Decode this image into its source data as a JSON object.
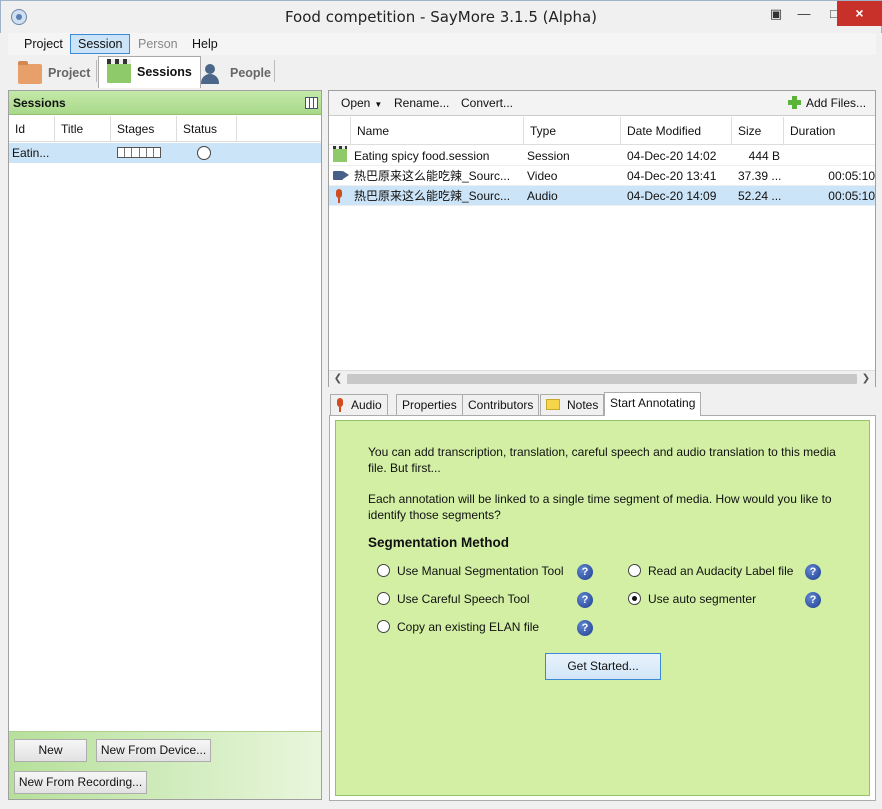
{
  "window": {
    "title": "Food competition - SayMore 3.1.5 (Alpha)",
    "close_glyph": "×",
    "maximize_glyph": "□",
    "minimize_glyph": "—"
  },
  "menu": {
    "items": [
      {
        "label": "Project",
        "state": "normal"
      },
      {
        "label": "Session",
        "state": "active"
      },
      {
        "label": "Person",
        "state": "disabled"
      },
      {
        "label": "Help",
        "state": "normal"
      }
    ]
  },
  "main_tabs": [
    {
      "label": "Project",
      "icon": "folder-icon"
    },
    {
      "label": "Sessions",
      "icon": "clapper-icon",
      "active": true
    },
    {
      "label": "People",
      "icon": "person-icon"
    }
  ],
  "sessions_panel": {
    "title": "Sessions",
    "columns": [
      "Id",
      "Title",
      "Stages",
      "Status"
    ],
    "rows": [
      {
        "id": "Eatin...",
        "title": "",
        "stages_segments": 6,
        "status": "empty-circle"
      }
    ],
    "buttons": {
      "new": "New",
      "new_from_device": "New From Device...",
      "new_from_recording": "New From Recording..."
    }
  },
  "files_panel": {
    "toolbar": {
      "open": "Open",
      "rename": "Rename...",
      "convert": "Convert...",
      "add_files": "Add Files..."
    },
    "columns": [
      "Name",
      "Type",
      "Date Modified",
      "Size",
      "Duration"
    ],
    "rows": [
      {
        "icon": "session-icon",
        "name": "Eating spicy food.session",
        "type": "Session",
        "date": "04-Dec-20 14:02",
        "size": "444 B",
        "duration": "",
        "selected": false
      },
      {
        "icon": "video-icon",
        "name": "热巴原来这么能吃辣_Sourc...",
        "type": "Video",
        "date": "04-Dec-20 13:41",
        "size": "37.39 ...",
        "duration": "00:05:10",
        "selected": false
      },
      {
        "icon": "audio-icon",
        "name": "热巴原来这么能吃辣_Sourc...",
        "type": "Audio",
        "date": "04-Dec-20 14:09",
        "size": "52.24 ...",
        "duration": "00:05:10",
        "selected": true
      }
    ]
  },
  "detail_tabs": [
    {
      "label": "Audio",
      "icon": "mic"
    },
    {
      "label": "Properties"
    },
    {
      "label": "Contributors"
    },
    {
      "label": "Notes",
      "icon": "note"
    },
    {
      "label": "Start Annotating",
      "active": true
    }
  ],
  "annotating": {
    "intro_line1": "You can add transcription, translation, careful speech and audio translation to this media",
    "intro_line2": "file. But first...",
    "question_line1": "Each annotation will be linked to a single time segment of media. How would you like to",
    "question_line2": "identify those segments?",
    "heading": "Segmentation Method",
    "options": [
      {
        "label": "Use Manual Segmentation Tool",
        "checked": false
      },
      {
        "label": "Read an Audacity Label file",
        "checked": false
      },
      {
        "label": "Use Careful Speech Tool",
        "checked": false
      },
      {
        "label": "Use auto segmenter",
        "checked": true
      },
      {
        "label": "Copy an existing ELAN file",
        "checked": false
      }
    ],
    "help_glyph": "?",
    "get_started": "Get Started..."
  }
}
